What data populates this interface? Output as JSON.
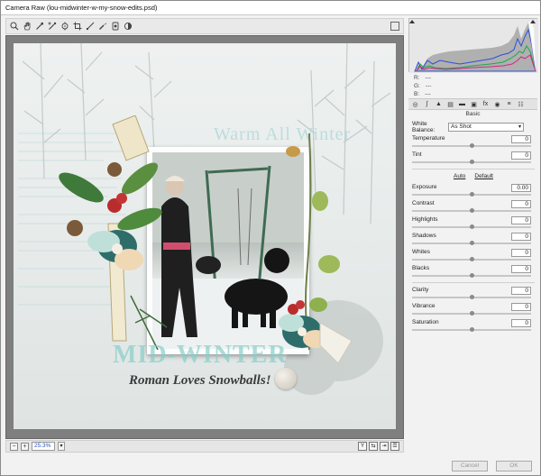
{
  "window": {
    "title": "Camera Raw (lou-midwinter-w-my-snow-edits.psd)"
  },
  "toolbar": {
    "tools": [
      "zoom-icon",
      "hand-icon",
      "white-balance-icon",
      "color-sampler-icon",
      "targeted-adjustment-icon",
      "crop-icon",
      "straighten-icon",
      "spot-removal-icon",
      "red-eye-icon",
      "adjustment-brush-icon"
    ]
  },
  "canvas": {
    "warm_text": "Warm All Winter",
    "mid_text": "MID-WINTER",
    "caption": "Roman Loves Snowballs!"
  },
  "zoom": {
    "value": "25.3%"
  },
  "readout": {
    "r_label": "R:",
    "r_value": "---",
    "g_label": "G:",
    "g_value": "---",
    "b_label": "B:",
    "b_value": "---"
  },
  "panel": {
    "title": "Basic",
    "white_balance_label": "White Balance:",
    "white_balance_value": "As Shot",
    "auto_label": "Auto",
    "default_label": "Default",
    "sliders_wb": [
      {
        "label": "Temperature",
        "value": "0",
        "level": 0.5
      },
      {
        "label": "Tint",
        "value": "0",
        "level": 0.5
      }
    ],
    "sliders_tone": [
      {
        "label": "Exposure",
        "value": "0.00",
        "level": 0.5
      },
      {
        "label": "Contrast",
        "value": "0",
        "level": 0.5
      },
      {
        "label": "Highlights",
        "value": "0",
        "level": 0.5
      },
      {
        "label": "Shadows",
        "value": "0",
        "level": 0.5
      },
      {
        "label": "Whites",
        "value": "0",
        "level": 0.5
      },
      {
        "label": "Blacks",
        "value": "0",
        "level": 0.5
      }
    ],
    "sliders_presence": [
      {
        "label": "Clarity",
        "value": "0",
        "level": 0.5
      },
      {
        "label": "Vibrance",
        "value": "0",
        "level": 0.5
      },
      {
        "label": "Saturation",
        "value": "0",
        "level": 0.5
      }
    ]
  },
  "footer": {
    "cancel_label": "Cancel",
    "ok_label": "OK"
  }
}
